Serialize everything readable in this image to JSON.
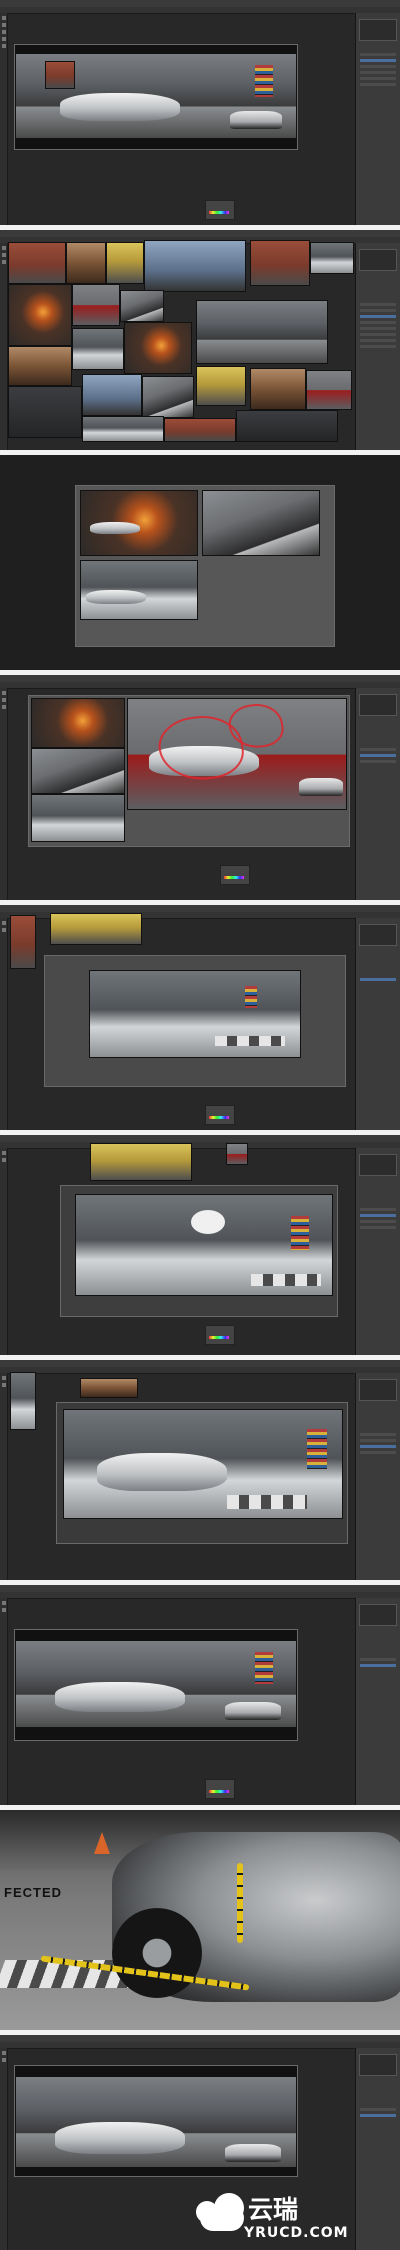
{
  "app": {
    "name": "Photoshop workspace",
    "accent_color": "#4a6f9f",
    "background_color": "#282828"
  },
  "closeup_text": "FECTED",
  "watermark": {
    "cn": "云瑞",
    "en": "YRUCD.COM",
    "icon": "cloud-logo-icon",
    "text_color": "#ffffff"
  },
  "icons": {
    "tool": "tool-icon",
    "navigator": "navigator-panel-icon",
    "layers": "layers-panel-icon"
  }
}
